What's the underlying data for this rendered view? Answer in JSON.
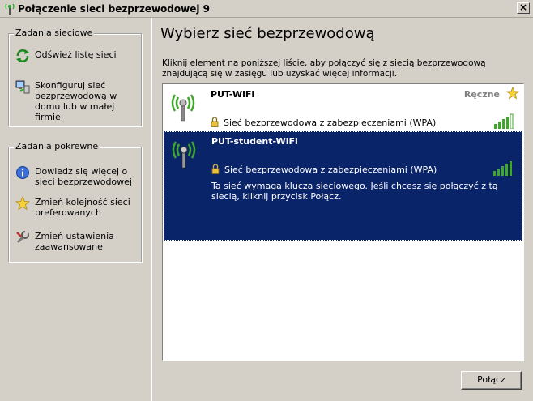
{
  "window": {
    "title": "Połączenie sieci bezprzewodowej 9",
    "title_icon": "wireless-icon",
    "close_label": "×"
  },
  "sidebar": {
    "network_tasks": {
      "title": "Zadania sieciowe",
      "items": [
        {
          "label": "Odśwież listę sieci",
          "icon": "refresh-icon"
        },
        {
          "label": "Skonfiguruj sieć bezprzewodową w domu lub w małej firmie",
          "icon": "network-setup-icon"
        }
      ]
    },
    "related_tasks": {
      "title": "Zadania pokrewne",
      "items": [
        {
          "label": "Dowiedz się więcej o sieci bezprzewodowej",
          "icon": "info-icon"
        },
        {
          "label": "Zmień kolejność sieci preferowanych",
          "icon": "star-icon"
        },
        {
          "label": "Zmień ustawienia zaawansowane",
          "icon": "settings-icon"
        }
      ]
    }
  },
  "main": {
    "title": "Wybierz sieć bezprzewodową",
    "instructions": "Kliknij element na poniższej liście, aby połączyć się z siecią bezprzewodową znajdującą się w zasięgu lub uzyskać więcej informacji."
  },
  "networks": [
    {
      "name": "PUT-WiFi",
      "security": "Sieć bezprzewodowa z zabezpieczeniami (WPA)",
      "mode": "Ręczne",
      "signal_bars": 4,
      "selected": false
    },
    {
      "name": "PUT-student-WiFi",
      "security": "Sieć bezprzewodowa z zabezpieczeniami (WPA)",
      "message": "Ta sieć wymaga klucza sieciowego. Jeśli chcesz się połączyć z tą siecią, kliknij przycisk Połącz.",
      "signal_bars": 5,
      "selected": true
    }
  ],
  "buttons": {
    "connect": "Połącz"
  },
  "colors": {
    "selection": "#0a246a",
    "signal": "#3fa82b",
    "window_bg": "#d4d0c8"
  }
}
